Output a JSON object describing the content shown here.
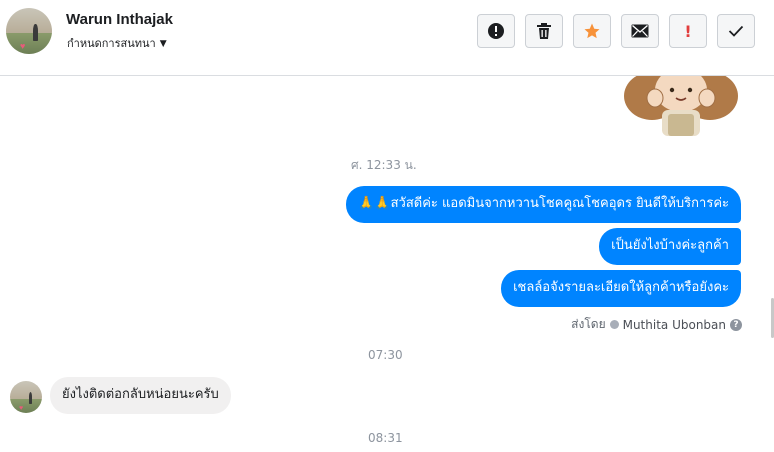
{
  "header": {
    "name": "Warun Inthajak",
    "subtitle": "กำหนดการสนทนา",
    "actions": [
      {
        "id": "mark-spam",
        "icon": "exclamation-circle-icon"
      },
      {
        "id": "delete",
        "icon": "trash-icon"
      },
      {
        "id": "star",
        "icon": "star-icon"
      },
      {
        "id": "mark-unread",
        "icon": "envelope-icon"
      },
      {
        "id": "important",
        "icon": "exclamation-icon"
      },
      {
        "id": "done",
        "icon": "checkmark-icon"
      }
    ]
  },
  "messages": {
    "timestamp_1": "ศ. 12:33 น.",
    "outgoing_1": "🙏🙏สวัสดีค่ะ แอดมินจากหวานโชคคูณโชคอุดร ยินดีให้บริการค่ะ",
    "outgoing_2": "เป็นยังไงบ้างค่ะลูกค้า",
    "outgoing_3": "เชลล์อจังรายละเอียดให้ลูกค้าหรือยังคะ",
    "sent_by_label": "ส่งโดย",
    "sent_by_name": "Muthita Ubonban",
    "timestamp_2": "07:30",
    "incoming_1": "ยังไงติดต่อกลับหน่อยนะครับ",
    "timestamp_3": "08:31"
  },
  "colors": {
    "outgoing_bubble": "#0084ff",
    "incoming_bubble": "#f1f0f0",
    "star": "#f7923a",
    "danger": "#e23d3d"
  }
}
